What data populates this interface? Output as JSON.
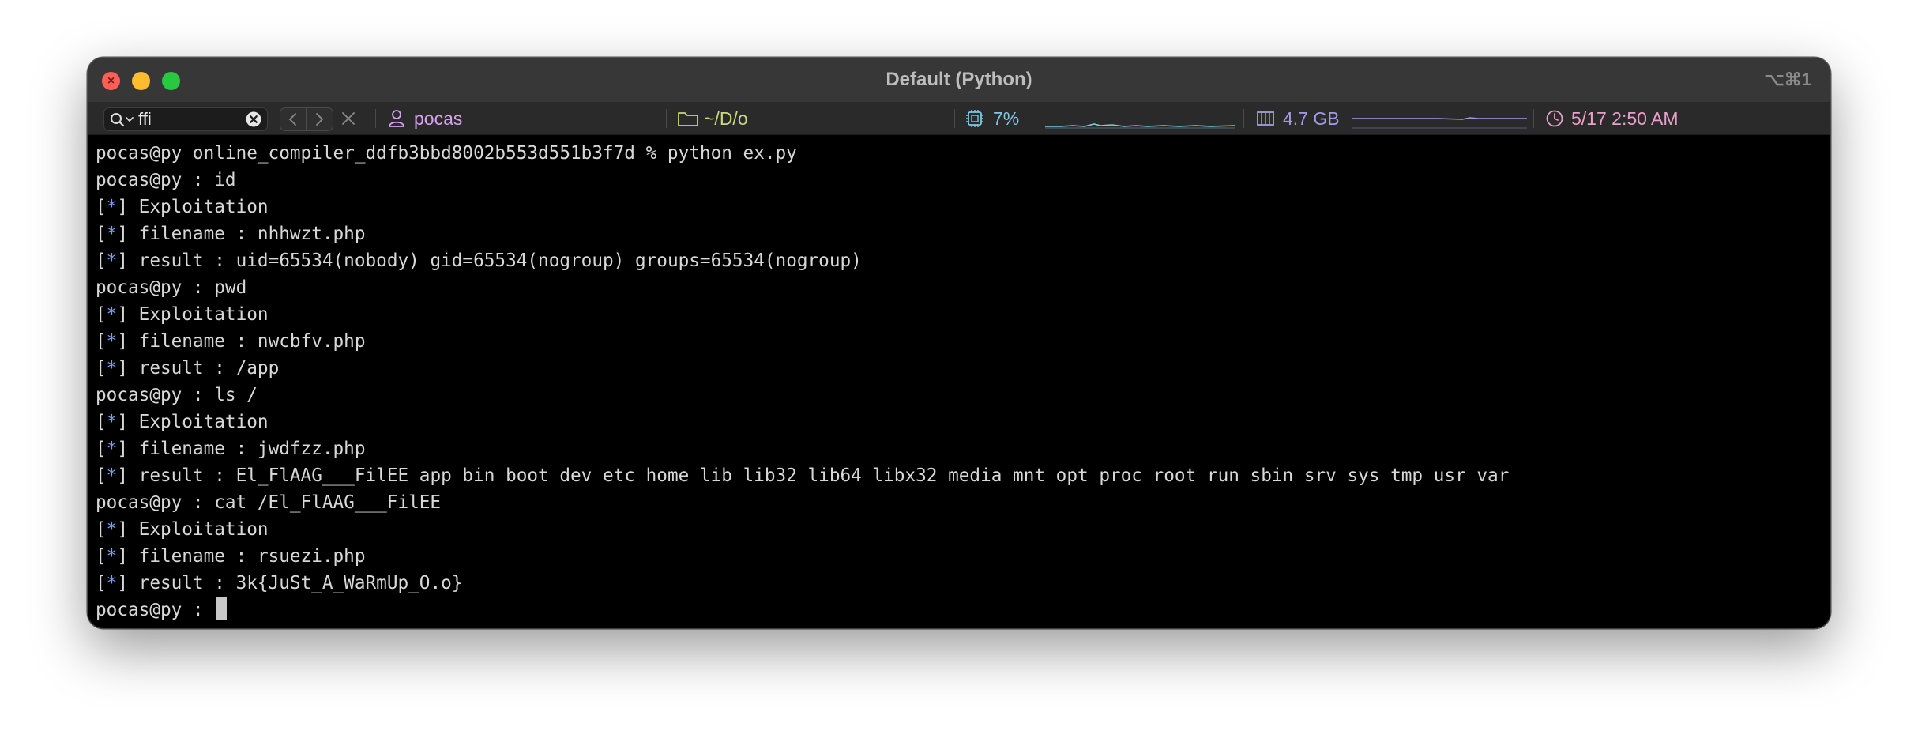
{
  "window": {
    "title": "Default (Python)",
    "shortcut": "⌥⌘1",
    "close_glyph": "×"
  },
  "statusbar": {
    "search_value": "ffi",
    "user": "pocas",
    "path": "~/D/o",
    "cpu": "7%",
    "memory": "4.7 GB",
    "clock": "5/17 2:50 AM",
    "colors": {
      "user": "#d8a0f0",
      "path": "#c8d87a",
      "cpu": "#7ec8e3",
      "memory": "#a29be8",
      "clock": "#e8a0c8"
    }
  },
  "terminal": {
    "lines": [
      {
        "text": "pocas@py online_compiler_ddfb3bbd8002b553d551b3f7d % python ex.py"
      },
      {
        "text": "pocas@py : id"
      },
      {
        "pre": "[",
        "star": "*",
        "post": "] Exploitation"
      },
      {
        "pre": "[",
        "star": "*",
        "post": "] filename : nhhwzt.php"
      },
      {
        "pre": "[",
        "star": "*",
        "post": "] result : uid=65534(nobody) gid=65534(nogroup) groups=65534(nogroup)"
      },
      {
        "text": "pocas@py : pwd"
      },
      {
        "pre": "[",
        "star": "*",
        "post": "] Exploitation"
      },
      {
        "pre": "[",
        "star": "*",
        "post": "] filename : nwcbfv.php"
      },
      {
        "pre": "[",
        "star": "*",
        "post": "] result : /app"
      },
      {
        "text": "pocas@py : ls /"
      },
      {
        "pre": "[",
        "star": "*",
        "post": "] Exploitation"
      },
      {
        "pre": "[",
        "star": "*",
        "post": "] filename : jwdfzz.php"
      },
      {
        "pre": "[",
        "star": "*",
        "post": "] result : El_FlAAG___FilEE app bin boot dev etc home lib lib32 lib64 libx32 media mnt opt proc root run sbin srv sys tmp usr var"
      },
      {
        "text": "pocas@py : cat /El_FlAAG___FilEE"
      },
      {
        "pre": "[",
        "star": "*",
        "post": "] Exploitation"
      },
      {
        "pre": "[",
        "star": "*",
        "post": "] filename : rsuezi.php"
      },
      {
        "pre": "[",
        "star": "*",
        "post": "] result : 3k{JuSt_A_WaRmUp_O.o}"
      }
    ],
    "prompt": "pocas@py : "
  }
}
